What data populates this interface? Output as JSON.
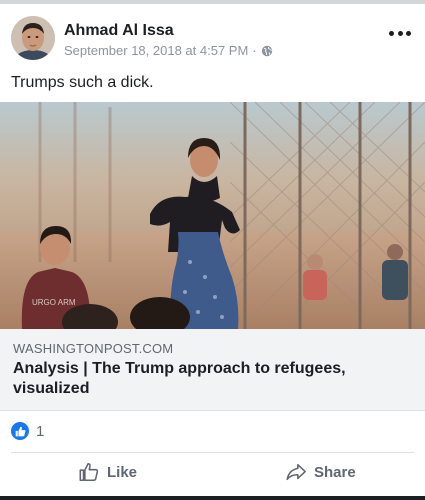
{
  "post": {
    "author": "Ahmad Al Issa",
    "timestamp": "September 18, 2018 at 4:57 PM",
    "separator": "·",
    "privacy_icon": "globe-icon",
    "text": "Trumps such a dick."
  },
  "link": {
    "domain": "WASHINGTONPOST.COM",
    "title": "Analysis | The Trump approach to refugees, visualized"
  },
  "reactions": {
    "icon": "thumbs-up-badge-icon",
    "count": "1"
  },
  "actions": {
    "like_label": "Like",
    "share_label": "Share"
  },
  "colors": {
    "accent": "#1877f2",
    "text": "#1c1e21",
    "muted": "#606770",
    "link_bg": "#f2f3f5"
  }
}
